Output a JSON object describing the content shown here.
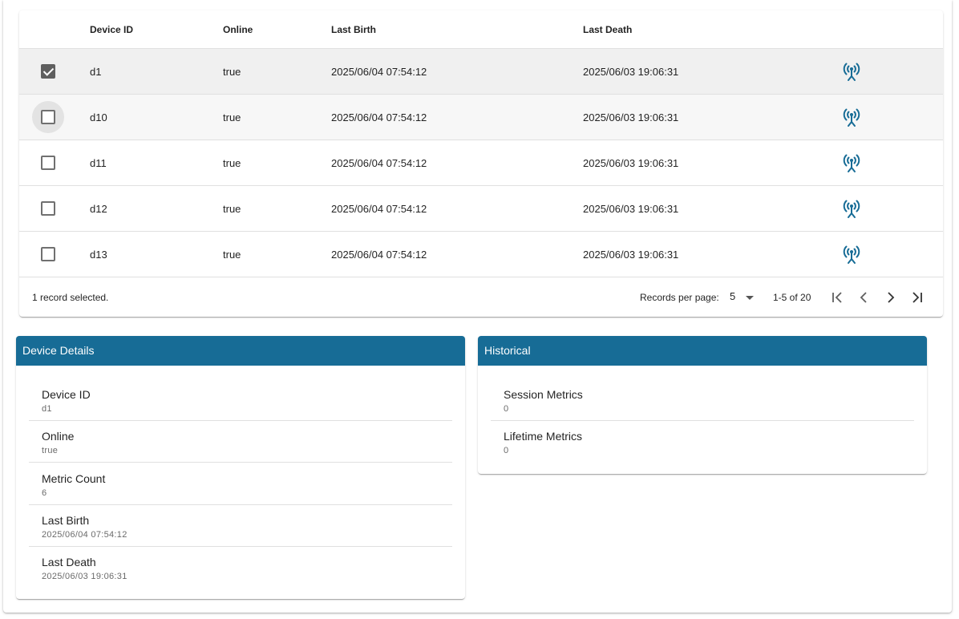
{
  "table": {
    "headers": {
      "device_id": "Device ID",
      "online": "Online",
      "last_birth": "Last Birth",
      "last_death": "Last Death"
    },
    "rows": [
      {
        "device_id": "d1",
        "online": "true",
        "last_birth": "2025/06/04 07:54:12",
        "last_death": "2025/06/03 19:06:31",
        "checked": true,
        "icon": "antenna-icon"
      },
      {
        "device_id": "d10",
        "online": "true",
        "last_birth": "2025/06/04 07:54:12",
        "last_death": "2025/06/03 19:06:31",
        "checked": false,
        "icon": "antenna-icon"
      },
      {
        "device_id": "d11",
        "online": "true",
        "last_birth": "2025/06/04 07:54:12",
        "last_death": "2025/06/03 19:06:31",
        "checked": false,
        "icon": "antenna-icon"
      },
      {
        "device_id": "d12",
        "online": "true",
        "last_birth": "2025/06/04 07:54:12",
        "last_death": "2025/06/03 19:06:31",
        "checked": false,
        "icon": "antenna-icon"
      },
      {
        "device_id": "d13",
        "online": "true",
        "last_birth": "2025/06/04 07:54:12",
        "last_death": "2025/06/03 19:06:31",
        "checked": false,
        "icon": "antenna-icon"
      }
    ],
    "footer": {
      "selected_text": "1 record selected.",
      "per_page_label": "Records per page:",
      "per_page_value": "5",
      "range": "1-5 of 20"
    }
  },
  "device_details": {
    "title": "Device Details",
    "items": [
      {
        "label": "Device ID",
        "value": "d1"
      },
      {
        "label": "Online",
        "value": "true"
      },
      {
        "label": "Metric Count",
        "value": "6"
      },
      {
        "label": "Last Birth",
        "value": "2025/06/04 07:54:12"
      },
      {
        "label": "Last Death",
        "value": "2025/06/03 19:06:31"
      }
    ]
  },
  "historical": {
    "title": "Historical",
    "items": [
      {
        "label": "Session Metrics",
        "value": "0"
      },
      {
        "label": "Lifetime Metrics",
        "value": "0"
      }
    ]
  },
  "colors": {
    "accent": "#176c96",
    "icon": "#176c96"
  }
}
